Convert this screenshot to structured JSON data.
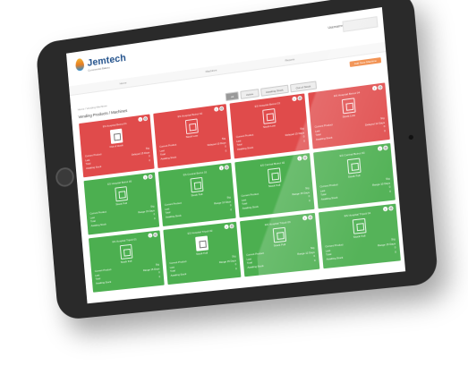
{
  "header": {
    "brand": "Jemtech",
    "brand_sub": "Commercial Bakery",
    "user_label": "Username",
    "nav": [
      "Home",
      "Machines",
      "Reports"
    ],
    "action_button": "Add New Machine"
  },
  "breadcrumb": "Home / Vending Machines",
  "page_title": "Vending Products / Machines",
  "tabs": [
    {
      "label": "All",
      "active": true
    },
    {
      "label": "Active",
      "active": false
    },
    {
      "label": "Awaiting Stock",
      "active": false
    },
    {
      "label": "Out of Stock",
      "active": false
    }
  ],
  "cards": [
    {
      "title": "ES Hospital Beirut 01",
      "status": "red",
      "machine": "solid",
      "status_text": "Out of stock",
      "rows": [
        [
          "Current Product",
          "Stg"
        ],
        [
          "Last",
          "Delayed 15 Days"
        ],
        [
          "Total",
          "0"
        ],
        [
          "Awaiting Stock",
          "0"
        ]
      ]
    },
    {
      "title": "ES Hospital Beirut 02",
      "status": "red",
      "machine": "outline",
      "status_text": "Stock Low",
      "rows": [
        [
          "Current Product",
          "Stg"
        ],
        [
          "Last",
          "Delayed 10 Days"
        ],
        [
          "Total",
          "0"
        ],
        [
          "Awaiting Stock",
          "0"
        ]
      ]
    },
    {
      "title": "ES Hospital Beirut 03",
      "status": "red",
      "machine": "outline",
      "status_text": "Stock Low",
      "rows": [
        [
          "Current Product",
          "Stg"
        ],
        [
          "Last",
          "Delayed 15 Days"
        ],
        [
          "Total",
          "0"
        ],
        [
          "Awaiting Stock",
          "0"
        ]
      ]
    },
    {
      "title": "ES Hospital Beirut 04",
      "status": "red",
      "machine": "outline",
      "status_text": "Stock Low",
      "rows": [
        [
          "Current Product",
          "Stg"
        ],
        [
          "Last",
          "Delayed 12 Days"
        ],
        [
          "Total",
          "0"
        ],
        [
          "Awaiting Stock",
          "0"
        ]
      ]
    },
    {
      "title": "ES Hospital Beirut 05",
      "status": "green",
      "machine": "outline",
      "status_text": "Stock Full",
      "rows": [
        [
          "Current Product",
          "Stg"
        ],
        [
          "Last",
          "Range 15 Days"
        ],
        [
          "Total",
          "0"
        ],
        [
          "Awaiting Stock",
          "0"
        ]
      ]
    },
    {
      "title": "ES Central Beirut 01",
      "status": "green",
      "machine": "outline",
      "status_text": "Stock Full",
      "rows": [
        [
          "Current Product",
          "Stg"
        ],
        [
          "Last",
          "Range 12 Days"
        ],
        [
          "Total",
          "0"
        ],
        [
          "Awaiting Stock",
          "0"
        ]
      ]
    },
    {
      "title": "ES Central Beirut 02",
      "status": "green",
      "machine": "outline",
      "status_text": "Stock Full",
      "rows": [
        [
          "Current Product",
          "Stg"
        ],
        [
          "Last",
          "Range 15 Days"
        ],
        [
          "Total",
          "0"
        ],
        [
          "Awaiting Stock",
          "0"
        ]
      ]
    },
    {
      "title": "ES Central Beirut 03",
      "status": "green",
      "machine": "outline",
      "status_text": "Stock Full",
      "rows": [
        [
          "Current Product",
          "Stg"
        ],
        [
          "Last",
          "Range 10 Days"
        ],
        [
          "Total",
          "0"
        ],
        [
          "Awaiting Stock",
          "0"
        ]
      ]
    },
    {
      "title": "ES Hospital Tripoli 01",
      "status": "green",
      "machine": "outline",
      "status_text": "Stock Full",
      "rows": [
        [
          "Current Product",
          "Stg"
        ],
        [
          "Last",
          "Range 15 Days"
        ],
        [
          "Total",
          "0"
        ],
        [
          "Awaiting Stock",
          "0"
        ]
      ]
    },
    {
      "title": "ES Hospital Tripoli 02",
      "status": "green",
      "machine": "solid",
      "status_text": "Stock Full",
      "rows": [
        [
          "Current Product",
          "Stg"
        ],
        [
          "Last",
          "Range 15 Days"
        ],
        [
          "Total",
          "0"
        ],
        [
          "Awaiting Stock",
          "0"
        ]
      ]
    },
    {
      "title": "ES Hospital Tripoli 03",
      "status": "green",
      "machine": "outline",
      "status_text": "Stock Full",
      "rows": [
        [
          "Current Product",
          "Stg"
        ],
        [
          "Last",
          "Range 12 Days"
        ],
        [
          "Total",
          "0"
        ],
        [
          "Awaiting Stock",
          "0"
        ]
      ]
    },
    {
      "title": "ES Hospital Tripoli 04",
      "status": "green",
      "machine": "outline",
      "status_text": "Stock Full",
      "rows": [
        [
          "Current Product",
          "Stg"
        ],
        [
          "Last",
          "Range 15 Days"
        ],
        [
          "Total",
          "0"
        ],
        [
          "Awaiting Stock",
          "0"
        ]
      ]
    }
  ],
  "colors": {
    "red": "#e04b4b",
    "green": "#4caf50",
    "accent": "#f0843c",
    "brand": "#1f4f8a"
  }
}
